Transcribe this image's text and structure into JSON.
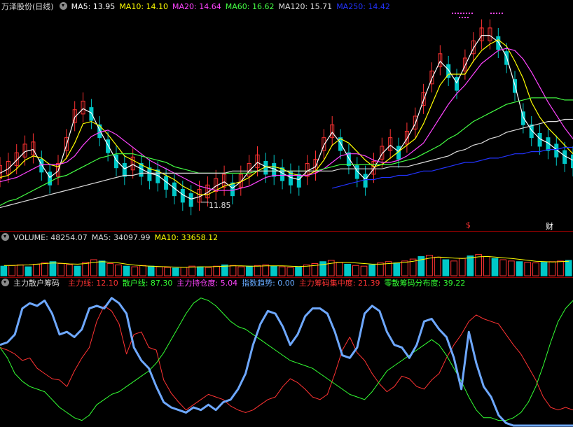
{
  "stock_title": "万泽股份(日线)",
  "main_ma": [
    {
      "label": "MA5: 13.95",
      "color": "#ffffff"
    },
    {
      "label": "MA10: 14.10",
      "color": "#ffff00"
    },
    {
      "label": "MA20: 14.64",
      "color": "#ff44ff"
    },
    {
      "label": "MA60: 16.62",
      "color": "#44ff44"
    },
    {
      "label": "MA120: 15.71",
      "color": "#dddddd"
    },
    {
      "label": "MA250: 14.42",
      "color": "#2233ff"
    }
  ],
  "volume_header": [
    {
      "label": "VOLUME: 48254.07",
      "color": "#dddddd"
    },
    {
      "label": "MA5: 34097.99",
      "color": "#dddddd"
    },
    {
      "label": "MA10: 33658.12",
      "color": "#ffff00"
    }
  ],
  "indicator_header": {
    "name": "主力散户筹码",
    "items": [
      {
        "label": "主力线: 12.10",
        "color": "#ff3333"
      },
      {
        "label": "散户线: 87.30",
        "color": "#33ff33"
      },
      {
        "label": "主力持仓度: 5.04",
        "color": "#ff44ff"
      },
      {
        "label": "指数趋势: 0.00",
        "color": "#66aaff"
      },
      {
        "label": "主力筹码集中度: 21.39",
        "color": "#ff3333"
      },
      {
        "label": "零散筹码分布度: 39.22",
        "color": "#33ff33"
      }
    ]
  },
  "markers": {
    "low_label": "11.85",
    "dollar": "$",
    "cai": "财"
  },
  "colors": {
    "up": "#ff3232",
    "down": "#00c8c8",
    "bg": "#000000",
    "sep": "#8b0000",
    "trend": "#6ea8ff"
  },
  "chart_data": [
    {
      "type": "candlestick",
      "title": "万泽股份(日线)",
      "annotation_low": 11.85,
      "ylim": [
        11,
        20.5
      ],
      "series": [
        {
          "name": "MA5",
          "values": [
            13.2,
            13.4,
            13.8,
            14.2,
            14.3,
            13.6,
            13.0,
            13.3,
            14.5,
            15.8,
            16.2,
            16.0,
            15.2,
            14.5,
            13.8,
            13.4,
            13.6,
            13.4,
            13.2,
            13.1,
            12.8,
            12.5,
            12.2,
            12.0,
            12.1,
            12.3,
            12.6,
            12.8,
            12.5,
            12.8,
            13.3,
            13.7,
            13.5,
            13.4,
            13.2,
            13.0,
            12.9,
            13.3,
            13.5,
            14.5,
            15.1,
            14.6,
            13.9,
            13.3,
            12.9,
            13.4,
            14.1,
            14.5,
            14.2,
            14.8,
            15.5,
            16.6,
            17.6,
            18.4,
            18.0,
            17.4,
            18.2,
            19.0,
            19.6,
            19.6,
            19.3,
            18.6,
            17.3,
            15.8,
            15.2,
            14.8,
            14.6,
            14.3,
            14.0,
            13.8
          ]
        },
        {
          "name": "MA10",
          "values": [
            13.0,
            13.1,
            13.4,
            13.8,
            14.0,
            13.9,
            13.6,
            13.5,
            13.9,
            14.6,
            15.5,
            15.6,
            15.4,
            15.0,
            14.5,
            14.0,
            13.8,
            13.6,
            13.4,
            13.3,
            13.1,
            12.9,
            12.6,
            12.4,
            12.2,
            12.2,
            12.4,
            12.6,
            12.7,
            12.8,
            13.0,
            13.3,
            13.5,
            13.5,
            13.4,
            13.2,
            13.1,
            13.1,
            13.3,
            13.8,
            14.5,
            14.8,
            14.6,
            14.2,
            13.8,
            13.5,
            13.6,
            13.9,
            14.2,
            14.5,
            14.8,
            15.5,
            16.4,
            17.3,
            17.8,
            17.8,
            17.8,
            18.4,
            18.9,
            19.2,
            19.4,
            19.1,
            18.4,
            17.6,
            16.5,
            15.8,
            15.3,
            14.9,
            14.5,
            14.1
          ]
        },
        {
          "name": "MA20",
          "values": [
            12.8,
            12.9,
            13.0,
            13.2,
            13.4,
            13.6,
            13.6,
            13.6,
            13.7,
            14.0,
            14.5,
            14.9,
            15.1,
            15.2,
            15.0,
            14.7,
            14.4,
            14.1,
            13.8,
            13.6,
            13.4,
            13.2,
            13.0,
            12.8,
            12.6,
            12.5,
            12.4,
            12.4,
            12.4,
            12.5,
            12.6,
            12.8,
            13.0,
            13.1,
            13.1,
            13.1,
            13.1,
            13.1,
            13.2,
            13.4,
            13.7,
            14.0,
            14.1,
            14.1,
            14.0,
            13.8,
            13.7,
            13.7,
            13.8,
            14.0,
            14.3,
            14.6,
            15.2,
            15.8,
            16.4,
            16.9,
            17.3,
            17.8,
            18.3,
            18.6,
            18.9,
            19.0,
            18.9,
            18.5,
            17.9,
            17.2,
            16.5,
            15.9,
            15.3,
            14.8
          ]
        },
        {
          "name": "MA60",
          "values": [
            11.7,
            11.9,
            12.0,
            12.2,
            12.4,
            12.6,
            12.8,
            13.0,
            13.1,
            13.3,
            13.5,
            13.7,
            13.9,
            14.0,
            14.1,
            14.1,
            14.1,
            14.0,
            13.9,
            13.8,
            13.7,
            13.5,
            13.4,
            13.3,
            13.2,
            13.2,
            13.2,
            13.2,
            13.2,
            13.2,
            13.2,
            13.3,
            13.3,
            13.3,
            13.3,
            13.3,
            13.3,
            13.3,
            13.3,
            13.4,
            13.5,
            13.6,
            13.6,
            13.6,
            13.6,
            13.6,
            13.6,
            13.6,
            13.7,
            13.8,
            13.9,
            14.1,
            14.3,
            14.5,
            14.8,
            15.0,
            15.3,
            15.6,
            15.8,
            16.0,
            16.2,
            16.4,
            16.5,
            16.6,
            16.7,
            16.7,
            16.7,
            16.7,
            16.6,
            16.6
          ]
        },
        {
          "name": "MA120",
          "values": [
            11.6,
            11.7,
            11.8,
            11.9,
            12.0,
            12.1,
            12.2,
            12.3,
            12.4,
            12.5,
            12.6,
            12.7,
            12.8,
            12.9,
            13.0,
            13.1,
            13.1,
            13.2,
            13.2,
            13.2,
            13.2,
            13.2,
            13.2,
            13.2,
            13.2,
            13.2,
            13.2,
            13.2,
            13.3,
            13.3,
            13.3,
            13.3,
            13.3,
            13.3,
            13.3,
            13.3,
            13.3,
            13.3,
            13.3,
            13.3,
            13.3,
            13.4,
            13.4,
            13.4,
            13.4,
            13.4,
            13.4,
            13.5,
            13.5,
            13.5,
            13.6,
            13.7,
            13.8,
            13.9,
            14.0,
            14.2,
            14.3,
            14.5,
            14.6,
            14.8,
            14.9,
            15.1,
            15.2,
            15.3,
            15.4,
            15.5,
            15.6,
            15.6,
            15.7,
            15.7
          ]
        },
        {
          "name": "MA250",
          "values": [
            null,
            null,
            null,
            null,
            null,
            null,
            null,
            null,
            null,
            null,
            null,
            null,
            null,
            null,
            null,
            null,
            null,
            null,
            null,
            null,
            null,
            null,
            null,
            null,
            null,
            null,
            null,
            null,
            null,
            null,
            null,
            null,
            null,
            null,
            null,
            null,
            null,
            null,
            null,
            null,
            12.5,
            12.6,
            12.7,
            12.8,
            12.9,
            12.9,
            13.0,
            13.0,
            13.1,
            13.1,
            13.2,
            13.3,
            13.3,
            13.4,
            13.5,
            13.6,
            13.7,
            13.7,
            13.8,
            13.9,
            13.9,
            14.0,
            14.1,
            14.1,
            14.2,
            14.2,
            14.3,
            14.3,
            14.4,
            14.4
          ]
        }
      ]
    },
    {
      "type": "bar",
      "title": "VOLUME",
      "values": [
        30,
        32,
        34,
        28,
        36,
        40,
        44,
        38,
        35,
        30,
        42,
        50,
        46,
        38,
        34,
        30,
        28,
        32,
        30,
        28,
        26,
        24,
        26,
        30,
        28,
        26,
        30,
        34,
        32,
        28,
        30,
        32,
        34,
        30,
        28,
        26,
        28,
        34,
        38,
        44,
        48,
        42,
        36,
        32,
        30,
        34,
        40,
        44,
        40,
        46,
        52,
        60,
        64,
        58,
        50,
        46,
        54,
        62,
        66,
        60,
        54,
        50,
        46,
        44,
        42,
        40,
        42,
        44,
        46,
        48
      ],
      "series": [
        {
          "name": "MA5",
          "values": [
            32,
            32,
            33,
            34,
            36,
            38,
            40,
            39,
            37,
            36,
            38,
            42,
            44,
            42,
            40,
            36,
            33,
            31,
            30,
            29,
            28,
            27,
            26,
            27,
            28,
            28,
            29,
            30,
            31,
            31,
            30,
            30,
            31,
            31,
            31,
            30,
            29,
            30,
            32,
            35,
            39,
            42,
            42,
            40,
            38,
            36,
            36,
            38,
            40,
            42,
            45,
            50,
            55,
            58,
            57,
            55,
            54,
            56,
            59,
            60,
            58,
            56,
            54,
            51,
            48,
            45,
            44,
            43,
            44,
            45
          ]
        }
      ],
      "ylim": [
        0,
        100
      ]
    },
    {
      "type": "line",
      "title": "主力散户筹码",
      "ylim": [
        0,
        100
      ],
      "series": [
        {
          "name": "主力线",
          "values": [
            60,
            58,
            55,
            50,
            52,
            44,
            40,
            36,
            35,
            30,
            42,
            52,
            60,
            80,
            92,
            88,
            78,
            55,
            70,
            72,
            60,
            58,
            35,
            25,
            18,
            12,
            16,
            20,
            24,
            22,
            20,
            15,
            12,
            10,
            12,
            16,
            20,
            22,
            30,
            36,
            33,
            28,
            22,
            20,
            24,
            40,
            58,
            68,
            56,
            50,
            40,
            32,
            26,
            30,
            38,
            36,
            30,
            28,
            35,
            40,
            52,
            62,
            70,
            80,
            85,
            82,
            80,
            78,
            70,
            62,
            55,
            45,
            35,
            22,
            14,
            12,
            14,
            12
          ]
        },
        {
          "name": "散户线",
          "values": [
            60,
            52,
            40,
            34,
            30,
            28,
            26,
            20,
            14,
            10,
            6,
            4,
            8,
            16,
            20,
            24,
            26,
            30,
            34,
            38,
            42,
            48,
            56,
            66,
            76,
            86,
            94,
            98,
            96,
            92,
            86,
            80,
            76,
            74,
            70,
            66,
            62,
            58,
            54,
            50,
            48,
            46,
            44,
            40,
            36,
            32,
            28,
            24,
            22,
            20,
            26,
            34,
            42,
            46,
            50,
            54,
            58,
            62,
            66,
            62,
            54,
            44,
            34,
            22,
            12,
            6,
            6,
            4,
            4,
            6,
            10,
            18,
            30,
            46,
            64,
            80,
            90,
            96
          ]
        },
        {
          "name": "指数趋势",
          "values": [
            62,
            64,
            70,
            90,
            94,
            92,
            96,
            86,
            70,
            72,
            68,
            74,
            90,
            92,
            90,
            98,
            94,
            86,
            60,
            50,
            44,
            30,
            18,
            14,
            12,
            10,
            14,
            12,
            16,
            12,
            18,
            20,
            28,
            40,
            62,
            78,
            88,
            86,
            76,
            62,
            70,
            84,
            90,
            90,
            86,
            72,
            54,
            52,
            60,
            86,
            92,
            88,
            72,
            62,
            60,
            52,
            62,
            80,
            82,
            74,
            68,
            52,
            28,
            72,
            48,
            30,
            22,
            8,
            2,
            0,
            0,
            0,
            0,
            0,
            0,
            0,
            0,
            0
          ]
        }
      ]
    }
  ]
}
